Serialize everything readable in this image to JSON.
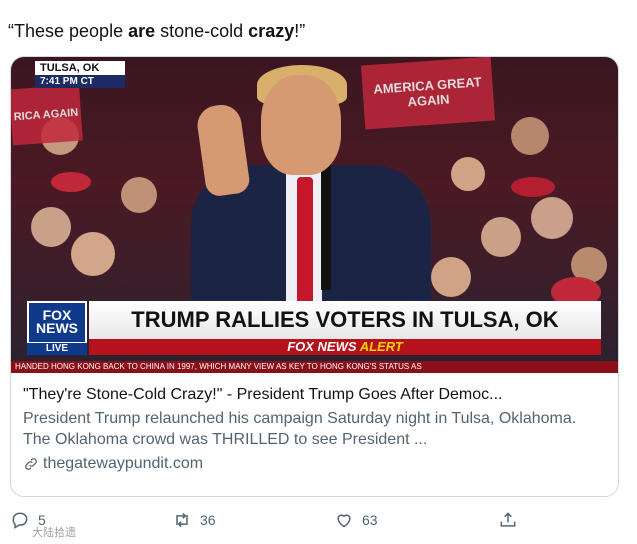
{
  "tweet": {
    "quote_open": "“These people ",
    "bold_1": "are",
    "mid": " stone-cold ",
    "bold_2": "crazy",
    "quote_close": "!”"
  },
  "media": {
    "location": "TULSA, OK",
    "time": "7:41 PM CT",
    "sign_text": "AMERICA GREAT AGAIN",
    "sign_left_text": "RICA AGAIN",
    "fox_logo_top": "FOX",
    "fox_logo_bottom": "NEWS",
    "fox_live": "LIVE",
    "headline": "TRUMP RALLIES VOTERS IN TULSA, OK",
    "alert_prefix": "FOX NEWS",
    "alert_word": "ALERT",
    "ticker": "HANDED HONG KONG BACK TO CHINA IN 1997, WHICH MANY VIEW AS KEY TO HONG KONG'S STATUS AS"
  },
  "card": {
    "title": "\"They're Stone-Cold Crazy!\" - President Trump Goes After Democ...",
    "description": "President Trump relaunched his campaign Saturday night in Tulsa, Oklahoma. The Oklahoma crowd was THRILLED to see President ...",
    "domain": "thegatewaypundit.com"
  },
  "actions": {
    "replies": "5",
    "retweets": "36",
    "likes": "63"
  },
  "watermark": "大陆拾遗"
}
